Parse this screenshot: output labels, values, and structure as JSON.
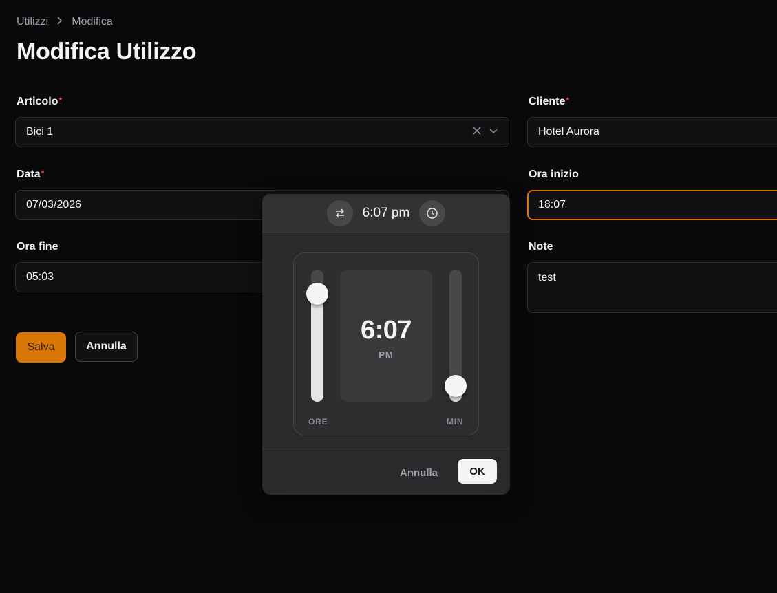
{
  "breadcrumb": {
    "items": [
      "Utilizzi",
      "Modifica"
    ],
    "separator": ">"
  },
  "page_title": "Modifica Utilizzo",
  "form": {
    "articolo": {
      "label": "Articolo",
      "required": "*",
      "value": "Bici 1"
    },
    "cliente": {
      "label": "Cliente",
      "required": "*",
      "value": "Hotel Aurora"
    },
    "data": {
      "label": "Data",
      "required": "*",
      "value": "07/03/2026"
    },
    "ora_inizio": {
      "label": "Ora inizio",
      "value": "18:07"
    },
    "ora_fine": {
      "label": "Ora fine",
      "value": "05:03"
    },
    "note": {
      "label": "Note",
      "value": "test"
    }
  },
  "actions": {
    "save_label": "Salva",
    "cancel_label": "Annulla"
  },
  "time_picker": {
    "header_time": "6:07 pm",
    "display_time": "6:07",
    "period": "PM",
    "hours_label": "ORE",
    "minutes_label": "MIN",
    "hour_level": 0.82,
    "minute_level": 0.12,
    "cancel_label": "Annulla",
    "ok_label": "OK",
    "icons": {
      "swap": "swap-arrows-icon",
      "clock": "clock-icon"
    }
  },
  "colors": {
    "accent": "#d97706",
    "background": "#09090b",
    "required": "#ef4444"
  }
}
